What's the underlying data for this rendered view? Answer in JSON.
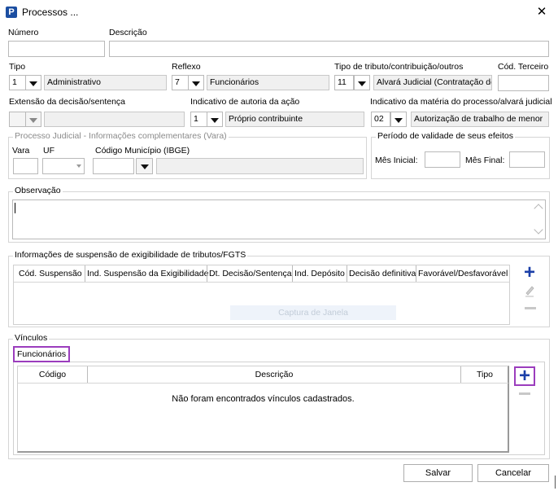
{
  "window": {
    "title": "Processos ...",
    "close_glyph": "✕",
    "app_icon": "P"
  },
  "fields": {
    "numero_label": "Número",
    "descricao_label": "Descrição",
    "tipo_label": "Tipo",
    "tipo_code": "1",
    "tipo_value": "Administrativo",
    "reflexo_label": "Reflexo",
    "reflexo_code": "7",
    "reflexo_value": "Funcionários",
    "tipo_tributo_label": "Tipo de tributo/contribuição/outros",
    "tipo_tributo_code": "11",
    "tipo_tributo_value": "Alvará Judicial (Contratação de",
    "cod_terceiro_label": "Cód. Terceiro",
    "extensao_label": "Extensão da decisão/sentença",
    "autoria_label": "Indicativo de autoria da ação",
    "autoria_code": "1",
    "autoria_value": "Próprio contribuinte",
    "materia_label": "Indicativo da matéria do processo/alvará judicial",
    "materia_code": "02",
    "materia_value": "Autorização de trabalho de menor"
  },
  "judicial_group": {
    "title": "Processo Judicial - Informações complementares (Vara)",
    "vara_label": "Vara",
    "uf_label": "UF",
    "municipio_label": "Código Município (IBGE)"
  },
  "validade_group": {
    "title": "Período de validade de seus efeitos",
    "mes_inicial_label": "Mês Inicial:",
    "mes_final_label": "Mês Final:"
  },
  "observacao": {
    "title": "Observação",
    "value": ""
  },
  "suspensao": {
    "title": "Informações de suspensão de exigibilidade de tributos/FGTS",
    "columns": [
      "Cód. Suspensão",
      "Ind. Suspensão da Exigibilidade",
      "Dt. Decisão/Sentença",
      "Ind. Depósito",
      "Decisão definitiva",
      "Favorável/Desfavorável"
    ],
    "watermark": "Captura de Janela",
    "add_glyph": "+",
    "remove_glyph": "—"
  },
  "vinculos": {
    "title": "Vínculos",
    "tab_label": "Funcionários",
    "columns": [
      "Código",
      "Descrição",
      "Tipo"
    ],
    "empty_message": "Não foram encontrados vínculos cadastrados.",
    "add_glyph": "+",
    "remove_glyph": "—"
  },
  "footer": {
    "save_label": "Salvar",
    "cancel_label": "Cancelar"
  },
  "colors": {
    "accent_blue": "#1b3fa8",
    "highlight_purple": "#9b3dbd"
  }
}
